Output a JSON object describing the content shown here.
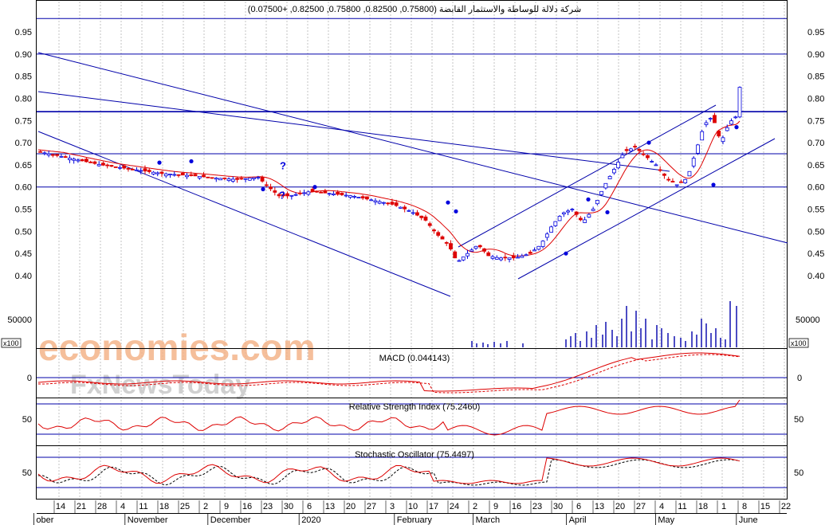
{
  "header": {
    "title": "شركة دلالة للوساطة والاستثمار القابضة (0.75800, 0.82500, 0.75800, 0.82500, +0.07500)"
  },
  "watermark": {
    "line1": "economies.com",
    "line2": "FxNewsToday"
  },
  "colors": {
    "up": "#0000dd",
    "down": "#dd0000",
    "ma": "#dd0000",
    "trendline": "#0000aa",
    "grid": "#aaaaaa",
    "watermark1": "#f4b48a",
    "watermark2": "#c8c8c8"
  },
  "chart_data": [
    {
      "type": "candlestick",
      "panel": "price",
      "y_ticks": [
        "0.95",
        "0.90",
        "0.85",
        "0.80",
        "0.75",
        "0.70",
        "0.65",
        "0.60",
        "0.55",
        "0.50",
        "0.45",
        "0.40"
      ],
      "ylim": [
        0.36,
        1.0
      ],
      "last_bar": {
        "open": 0.758,
        "high": 0.825,
        "low": 0.758,
        "close": 0.825,
        "change": 0.075
      },
      "horizontal_levels": [
        0.98,
        0.9,
        0.77,
        0.675,
        0.6
      ],
      "x_tick_labels": [
        "14",
        "21",
        "28",
        "4",
        "11",
        "18",
        "25",
        "2",
        "9",
        "16",
        "23",
        "30",
        "6",
        "13",
        "20",
        "27",
        "3",
        "10",
        "17",
        "24",
        "2",
        "9",
        "16",
        "23",
        "30",
        "6",
        "13",
        "20",
        "27",
        "4",
        "11",
        "18",
        "1",
        "8",
        "15",
        "22"
      ],
      "month_labels": [
        "ober",
        "November",
        "December",
        "2020",
        "February",
        "March",
        "April",
        "May",
        "June"
      ]
    },
    {
      "type": "bar",
      "panel": "volume",
      "y_ticks": [
        "50000"
      ],
      "scale_label": "x100"
    },
    {
      "type": "line",
      "panel": "macd",
      "title": "MACD (0.044143)",
      "y_ticks": [
        "0"
      ]
    },
    {
      "type": "line",
      "panel": "rsi",
      "title": "Relative Strength Index (75.2460)",
      "y_ticks": [
        "50"
      ],
      "value": 75.246
    },
    {
      "type": "line",
      "panel": "stochastic",
      "title": "Stochastic Oscillator (75.4497)",
      "y_ticks": [
        "50"
      ],
      "value": 75.4497
    }
  ]
}
